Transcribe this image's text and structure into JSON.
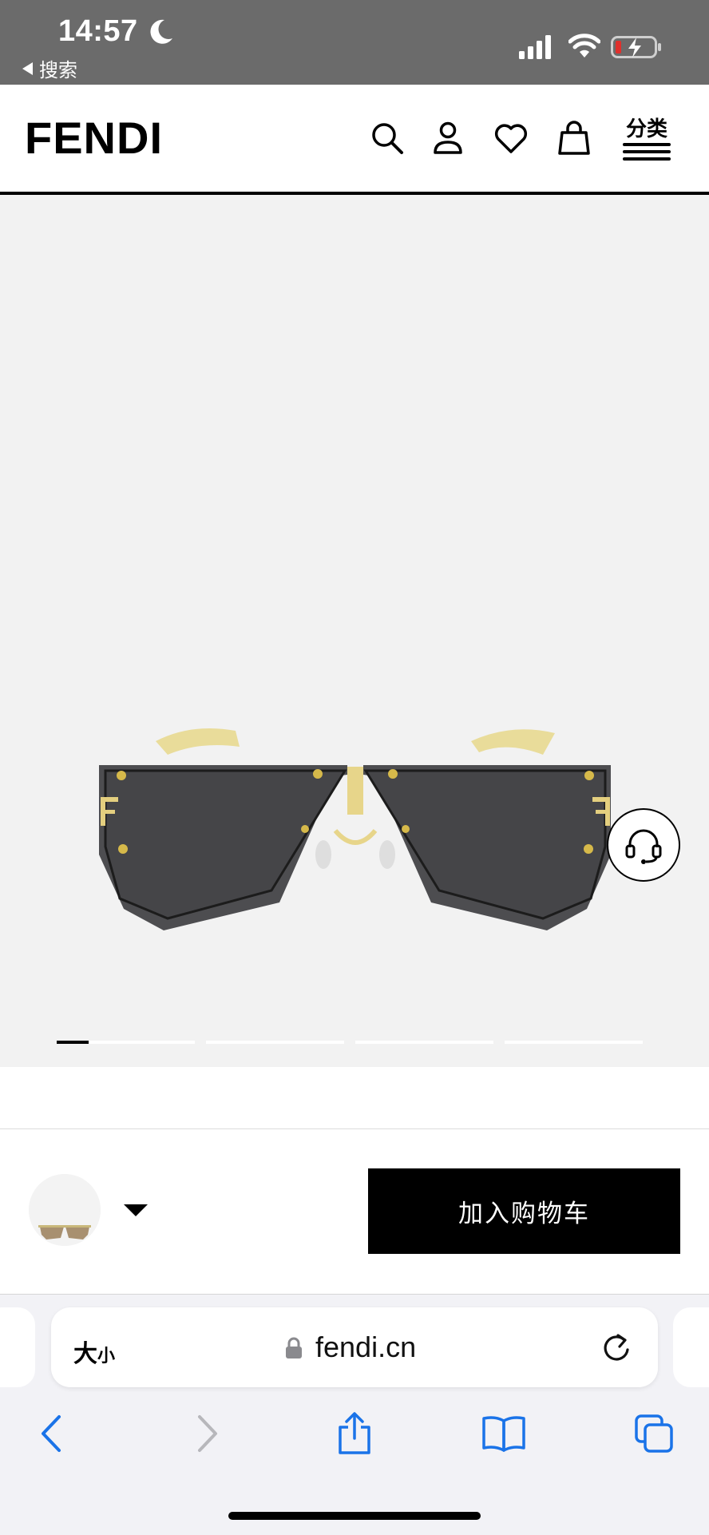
{
  "status_bar": {
    "time": "14:57",
    "back_label": "搜索",
    "icons": [
      "moon-icon",
      "signal-icon",
      "wifi-icon",
      "battery-charging-icon"
    ]
  },
  "header": {
    "logo": "FENDI",
    "icons": [
      "search-icon",
      "account-icon",
      "wishlist-heart-icon",
      "shopping-bag-icon"
    ],
    "category_label": "分类"
  },
  "gallery": {
    "slide_count": 4,
    "current_slide": 1,
    "current_progress": 0.23
  },
  "purchase": {
    "add_to_cart_label": "加入购物车"
  },
  "browser": {
    "text_size_label_big": "大",
    "text_size_label_small": "小",
    "url": "fendi.cn"
  },
  "colors": {
    "status_bar_bg": "#6b6b6b",
    "hero_bg": "#f2f2f2",
    "button_bg": "#000000",
    "ios_blue": "#1a73e8"
  }
}
